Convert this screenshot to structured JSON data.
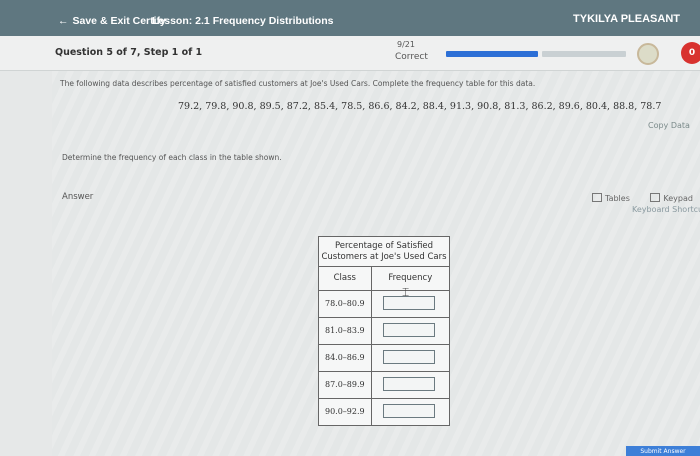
{
  "topbar": {
    "back_label": "Save & Exit Certify",
    "lesson": "Lesson: 2.1 Frequency Distributions",
    "user": "TYKILYA PLEASANT"
  },
  "header": {
    "question": "Question 5 of 7, Step 1 of 1",
    "score": "9/21",
    "status": "Correct",
    "badge": "0",
    "progress_fraction": 0.52
  },
  "question": {
    "intro": "The following data describes percentage of satisfied customers at Joe's Used Cars. Complete the frequency table for this data.",
    "data": "79.2, 79.8, 90.8, 89.5, 87.2, 85.4, 78.5, 86.6, 84.2, 88.4, 91.3, 90.8, 81.3, 86.2, 89.6, 80.4, 88.8, 78.7",
    "copy_label": "Copy Data",
    "determine": "Determine the frequency of each class in the table shown."
  },
  "answer": {
    "label": "Answer",
    "tables_label": "Tables",
    "keypad_label": "Keypad",
    "shortcuts_label": "Keyboard Shortcuts"
  },
  "table": {
    "caption": "Percentage of Satisfied Customers at Joe's Used Cars",
    "col_class": "Class",
    "col_freq": "Frequency",
    "rows": [
      {
        "class": "78.0–80.9",
        "freq": ""
      },
      {
        "class": "81.0–83.9",
        "freq": ""
      },
      {
        "class": "84.0–86.9",
        "freq": ""
      },
      {
        "class": "87.0–89.9",
        "freq": ""
      },
      {
        "class": "90.0–92.9",
        "freq": ""
      }
    ]
  },
  "submit_label": "Submit Answer",
  "colors": {
    "topbar": "#5f7780",
    "progress": "#2c6fd6",
    "badge": "#d8322f",
    "submit": "#3d7fd8"
  }
}
